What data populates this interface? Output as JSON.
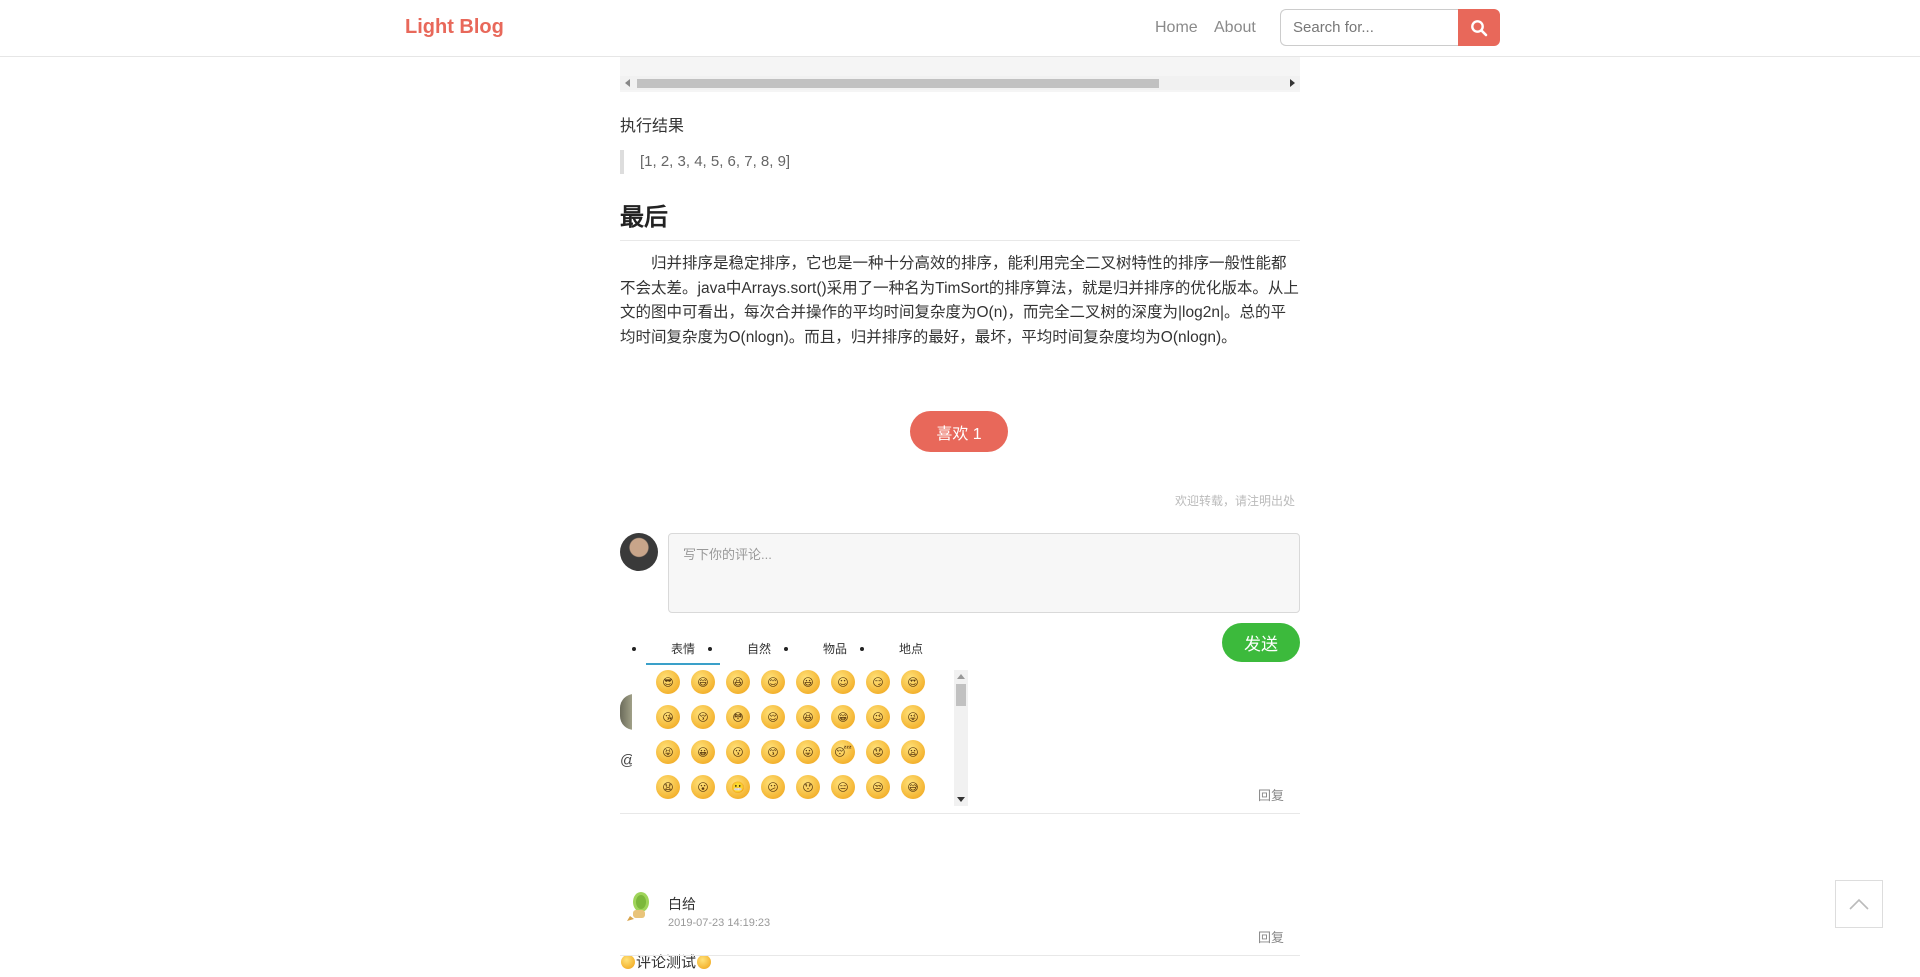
{
  "nav": {
    "brand": "Light Blog",
    "links": [
      "Home",
      "About"
    ],
    "search_placeholder": "Search for...",
    "search_icon": "search-icon"
  },
  "article": {
    "result_label": "执行结果",
    "result_output": "[1, 2, 3, 4, 5, 6, 7, 8, 9]",
    "section_title": "最后",
    "paragraph": "归并排序是稳定排序，它也是一种十分高效的排序，能利用完全二叉树特性的排序一般性能都不会太差。java中Arrays.sort()采用了一种名为TimSort的排序算法，就是归并排序的优化版本。从上文的图中可看出，每次合并操作的平均时间复杂度为O(n)，而完全二叉树的深度为|log2n|。总的平均时间复杂度为O(nlogn)。而且，归并排序的最好，最坏，平均时间复杂度均为O(nlogn)。",
    "like_label": "喜欢 1",
    "repost_note": "欢迎转载，请注明出处"
  },
  "comment_form": {
    "placeholder": "写下你的评论...",
    "send_label": "发送"
  },
  "emoji_picker": {
    "tabs": [
      "表情",
      "自然",
      "物品",
      "地点"
    ],
    "active_tab": "表情",
    "emojis": [
      "😎",
      "😄",
      "😆",
      "😊",
      "😃",
      "☺",
      "😏",
      "😍",
      "😘",
      "😚",
      "😳",
      "😌",
      "😆",
      "😁",
      "😉",
      "😜",
      "😝",
      "😀",
      "😗",
      "😙",
      "😛",
      "😴",
      "😟",
      "😦",
      "😧",
      "😮",
      "😬",
      "😕",
      "😯",
      "😑",
      "😒",
      "😅"
    ]
  },
  "comments": [
    {
      "mention": "@",
      "reply_label": "回复"
    },
    {
      "author": "白给",
      "time": "2019-07-23 14:19:23",
      "text": "评论测试",
      "reply_label": "回复"
    }
  ],
  "colors": {
    "accent": "#e8685a",
    "send": "#3cba3c",
    "tab_underline": "#3aa0c9"
  },
  "back_to_top_icon": "chevron-up-icon"
}
